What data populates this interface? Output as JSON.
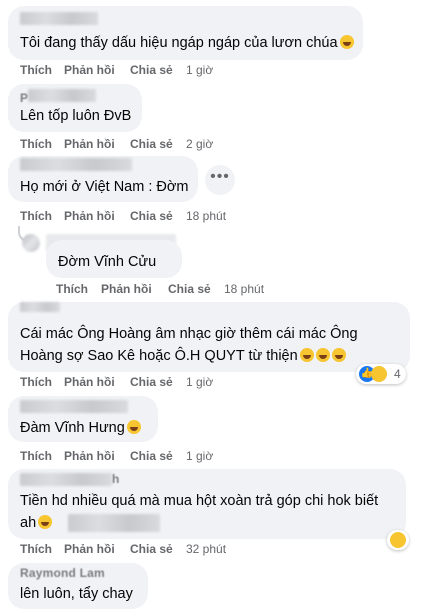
{
  "actions": {
    "like": "Thích",
    "reply": "Phản hồi",
    "share": "Chia sẻ"
  },
  "comments": [
    {
      "text": "Tôi đang thấy dấu hiệu ngáp ngáp của lươn chúa",
      "emoji": "grin-sweat-emoji",
      "time": "1 giờ"
    },
    {
      "name_fragment": "P",
      "text": "Lên tốp luôn ĐvB",
      "time": "2 giờ"
    },
    {
      "text": "Họ mới ở Việt Nam : Đờm",
      "time": "18 phút",
      "more": "•••"
    },
    {
      "text": "Đờm Vĩnh Cửu",
      "time": "18 phút"
    },
    {
      "text_line1": "Cái mác Ông Hoàng âm nhạc giờ thêm cái mác Ông",
      "text_line2": "Hoàng sợ Sao Kê hoặc Ô.H QUYT từ thiện",
      "emojis": [
        "laugh-cry-emoji",
        "laugh-cry-emoji",
        "laugh-cry-emoji"
      ],
      "time": "1 giờ",
      "reactions": {
        "icons": [
          "like-reaction-icon",
          "haha-reaction-icon"
        ],
        "count": "4"
      }
    },
    {
      "text": "Đàm Vĩnh Hưng",
      "emoji": "laugh-cry-emoji",
      "time": "1 giờ"
    },
    {
      "name_fragment": "h",
      "text_line1": "Tiền hd nhiều quá mà mua hột xoàn trả góp chi hok biết",
      "text_line2": "ah",
      "emoji": "laugh-cry-emoji",
      "time": "32 phút",
      "reactions": {
        "icons": [
          "haha-reaction-icon"
        ]
      }
    },
    {
      "name": "Raymond Lam",
      "text": "lên luôn, tẩy chay"
    }
  ]
}
